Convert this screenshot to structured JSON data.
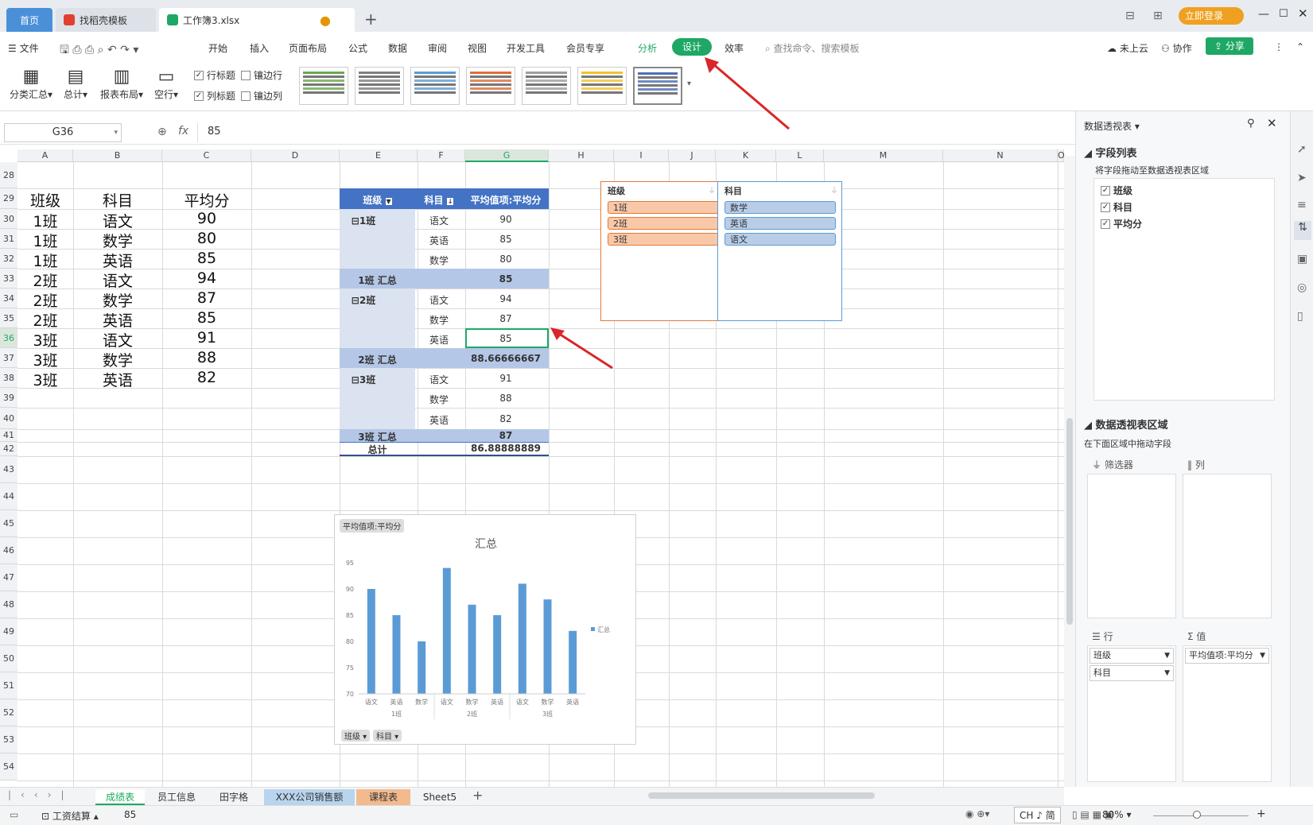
{
  "tabs": {
    "home": "首页",
    "template": "找稻壳模板",
    "workbook": "工作簿3.xlsx",
    "login": "立即登录"
  },
  "menu": {
    "file": "文件",
    "items": [
      "开始",
      "插入",
      "页面布局",
      "公式",
      "数据",
      "审阅",
      "视图",
      "开发工具",
      "会员专享"
    ],
    "analyze": "分析",
    "design": "设计",
    "efficiency": "效率",
    "search": "查找命令、搜索模板",
    "cloud": "未上云",
    "collab": "协作",
    "share": "分享"
  },
  "ribbon": {
    "subtotal": "分类汇总",
    "total": "总计",
    "layout": "报表布局",
    "blank": "空行",
    "row_header": "行标题",
    "banded_rows": "镶边行",
    "col_header": "列标题",
    "banded_cols": "镶边列",
    "style_colors": [
      "#6aa84f",
      "#7f7f7f",
      "#5b9bd5",
      "#e06c3b",
      "#9e9e9e",
      "#f1c232",
      "#4a6fb5"
    ]
  },
  "formula": {
    "cell_ref": "G36",
    "fx": "fx",
    "value": "85"
  },
  "columns": [
    "A",
    "B",
    "C",
    "D",
    "E",
    "F",
    "G",
    "H",
    "I",
    "J",
    "K",
    "L",
    "M",
    "N",
    "O"
  ],
  "rows": [
    "28",
    "29",
    "30",
    "31",
    "32",
    "33",
    "34",
    "35",
    "36",
    "37",
    "38",
    "39",
    "40",
    "41",
    "42",
    "43",
    "44",
    "45",
    "46",
    "47",
    "48",
    "49",
    "50",
    "51",
    "52",
    "53",
    "54"
  ],
  "source": {
    "headers": [
      "班级",
      "科目",
      "平均分"
    ],
    "data": [
      [
        "1班",
        "语文",
        "90"
      ],
      [
        "1班",
        "数学",
        "80"
      ],
      [
        "1班",
        "英语",
        "85"
      ],
      [
        "2班",
        "语文",
        "94"
      ],
      [
        "2班",
        "数学",
        "87"
      ],
      [
        "2班",
        "英语",
        "85"
      ],
      [
        "3班",
        "语文",
        "91"
      ],
      [
        "3班",
        "数学",
        "88"
      ],
      [
        "3班",
        "英语",
        "82"
      ]
    ]
  },
  "pivot": {
    "headers": [
      "班级",
      "科目",
      "平均值项:平均分"
    ],
    "groups": [
      {
        "label": "⊟1班",
        "rows": [
          [
            "语文",
            "90"
          ],
          [
            "英语",
            "85"
          ],
          [
            "数学",
            "80"
          ]
        ],
        "subtotal": "1班 汇总",
        "subval": "85"
      },
      {
        "label": "⊟2班",
        "rows": [
          [
            "语文",
            "94"
          ],
          [
            "数学",
            "87"
          ],
          [
            "英语",
            "85"
          ]
        ],
        "subtotal": "2班 汇总",
        "subval": "88.66666667"
      },
      {
        "label": "⊟3班",
        "rows": [
          [
            "语文",
            "91"
          ],
          [
            "数学",
            "88"
          ],
          [
            "英语",
            "82"
          ]
        ],
        "subtotal": "3班 汇总",
        "subval": "87"
      }
    ],
    "grand": "总计",
    "grandval": "86.88888889"
  },
  "slicers": {
    "class": {
      "title": "班级",
      "items": [
        "1班",
        "2班",
        "3班"
      ]
    },
    "subject": {
      "title": "科目",
      "items": [
        "数学",
        "英语",
        "语文"
      ]
    }
  },
  "chart_data": {
    "type": "bar",
    "title": "汇总",
    "field_button": "平均值项:平均分",
    "categories": [
      "语文",
      "英语",
      "数学",
      "语文",
      "数学",
      "英语",
      "语文",
      "数学",
      "英语"
    ],
    "groups": [
      "1班",
      "2班",
      "3班"
    ],
    "series": [
      {
        "name": "汇总",
        "values": [
          90,
          85,
          80,
          94,
          87,
          85,
          91,
          88,
          82
        ]
      }
    ],
    "ylim": [
      70,
      95
    ],
    "yticks": [
      "70",
      "75",
      "80",
      "85",
      "90",
      "95"
    ],
    "filters": [
      "班级",
      "科目"
    ],
    "color": "#5b9bd5"
  },
  "pane": {
    "title": "数据透视表",
    "fields_title": "字段列表",
    "fields_hint": "将字段拖动至数据透视表区域",
    "fields": [
      "班级",
      "科目",
      "平均分"
    ],
    "areas_title": "数据透视表区域",
    "areas_hint": "在下面区域中拖动字段",
    "filter": "筛选器",
    "cols": "列",
    "rows": "行",
    "values": "值",
    "row_items": [
      "班级",
      "科目"
    ],
    "value_items": [
      "平均值项:平均分"
    ]
  },
  "sheets": [
    "成绩表",
    "员工信息",
    "田字格",
    "XXX公司销售额",
    "课程表",
    "Sheet5"
  ],
  "status": {
    "mode": "工资结算",
    "value": "85",
    "ime": "CH ♪ 简",
    "zoom": "80%"
  }
}
